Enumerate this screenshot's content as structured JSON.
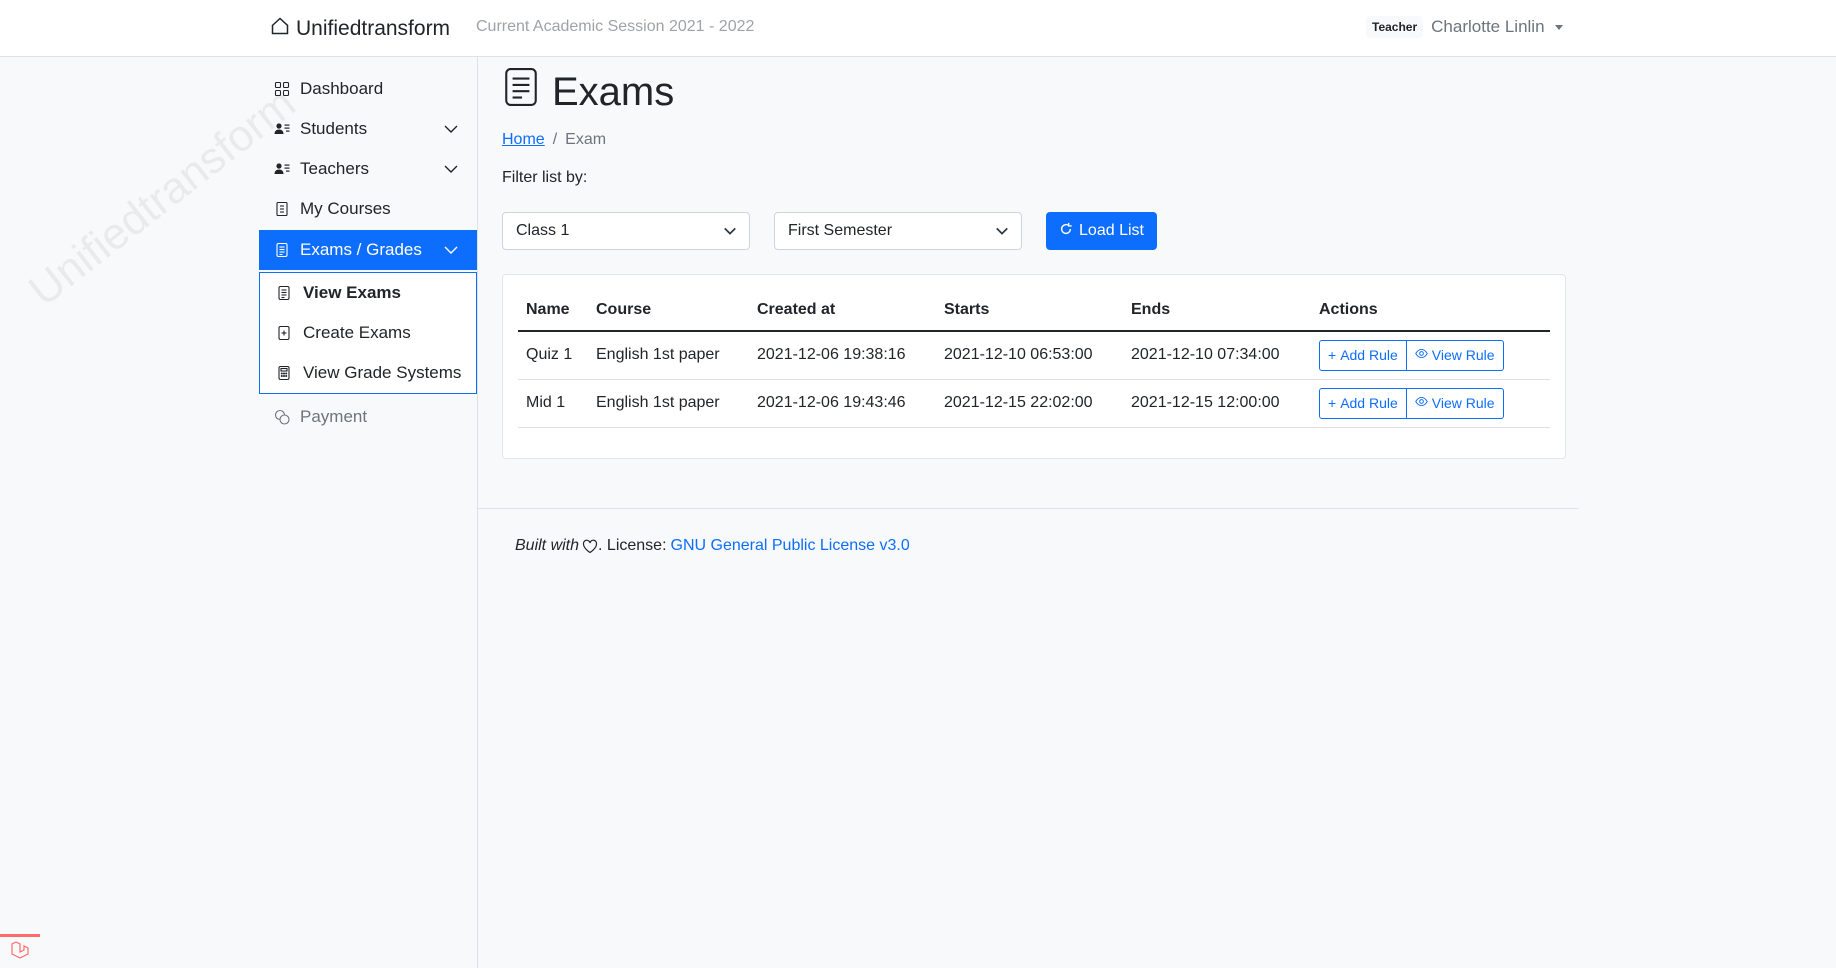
{
  "navbar": {
    "brand": "Unifiedtransform",
    "session": "Current Academic Session 2021 - 2022",
    "role": "Teacher",
    "user_name": "Charlotte Linlin"
  },
  "sidebar": {
    "watermark": "Unifiedtransform",
    "items": [
      {
        "label": "Dashboard",
        "icon": "grid-icon"
      },
      {
        "label": "Students",
        "icon": "person-lines-icon"
      },
      {
        "label": "Teachers",
        "icon": "person-lines-icon"
      },
      {
        "label": "My Courses",
        "icon": "journal-icon"
      },
      {
        "label": "Exams / Grades",
        "icon": "file-text-icon"
      }
    ],
    "submenu": [
      {
        "label": "View Exams",
        "icon": "file-text-icon"
      },
      {
        "label": "Create Exams",
        "icon": "file-plus-icon"
      },
      {
        "label": "View Grade Systems",
        "icon": "calculator-icon"
      }
    ],
    "payment": "Payment"
  },
  "page": {
    "title": "Exams",
    "breadcrumb_home": "Home",
    "breadcrumb_sep": "/",
    "breadcrumb_current": "Exam",
    "filter_label": "Filter list by:",
    "class_select": "Class 1",
    "semester_select": "First Semester",
    "load_button": "Load List"
  },
  "table": {
    "headers": [
      "Name",
      "Course",
      "Created at",
      "Starts",
      "Ends",
      "Actions"
    ],
    "rows": [
      {
        "name": "Quiz 1",
        "course": "English 1st paper",
        "created": "2021-12-06 19:38:16",
        "starts": "2021-12-10 06:53:00",
        "ends": "2021-12-10 07:34:00"
      },
      {
        "name": "Mid 1",
        "course": "English 1st paper",
        "created": "2021-12-06 19:43:46",
        "starts": "2021-12-15 22:02:00",
        "ends": "2021-12-15 12:00:00"
      }
    ],
    "add_rule": "Add Rule",
    "view_rule": "View Rule"
  },
  "footer": {
    "built_with": "Built with",
    "license_prefix": ". License:",
    "license_link": "GNU General Public License v3.0"
  },
  "colors": {
    "primary": "#0d6efd",
    "text": "#212529",
    "muted": "#6c757d",
    "background": "#f8f9fa"
  }
}
